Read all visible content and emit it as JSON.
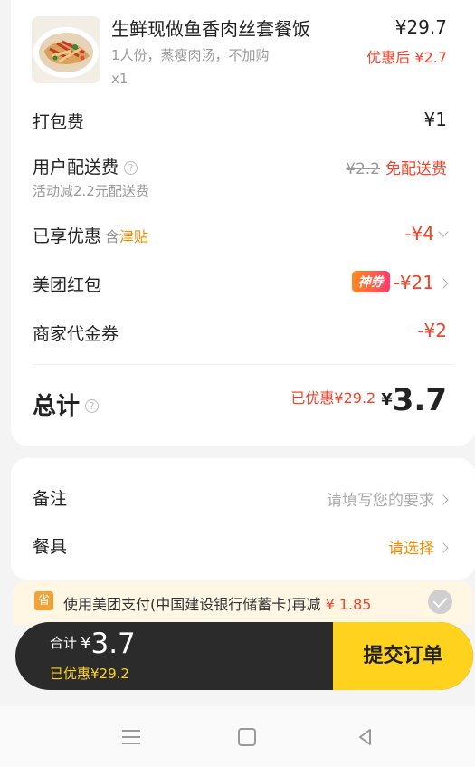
{
  "item": {
    "name": "生鲜现做鱼香肉丝套餐饭",
    "desc": "1人份，蒸瘦肉汤，不加购",
    "qty": "x1",
    "price": "¥29.7",
    "after_discount": "优惠后 ¥2.7"
  },
  "packing": {
    "label": "打包费",
    "value": "¥1"
  },
  "delivery": {
    "label": "用户配送费",
    "sub": "活动减2.2元配送费",
    "original": "¥2.2",
    "free": "免配送费"
  },
  "discount": {
    "label": "已享优惠",
    "hint_prefix": "含",
    "hint_link": "津贴",
    "value": "-¥4"
  },
  "redpacket": {
    "label": "美团红包",
    "badge": "神券",
    "value": "-¥21"
  },
  "voucher": {
    "label": "商家代金券",
    "value": "-¥2"
  },
  "total": {
    "label": "总计",
    "saved": "已优惠¥29.2",
    "yen": "¥",
    "amount": "3.7"
  },
  "remark": {
    "label": "备注",
    "placeholder": "请填写您的要求"
  },
  "tableware": {
    "label": "餐具",
    "value": "请选择"
  },
  "promo": {
    "icon": "省",
    "text": "使用美团支付(中国建设银行储蓄卡)再减",
    "amount": "¥ 1.85"
  },
  "bottom_bar": {
    "label": "合计",
    "yen": "¥",
    "amount": "3.7",
    "saved": "已优惠¥29.2",
    "submit": "提交订单"
  },
  "colors": {
    "accent_red": "#f2432c",
    "brand_yellow": "#ffd21e",
    "orange": "#f08c00"
  }
}
